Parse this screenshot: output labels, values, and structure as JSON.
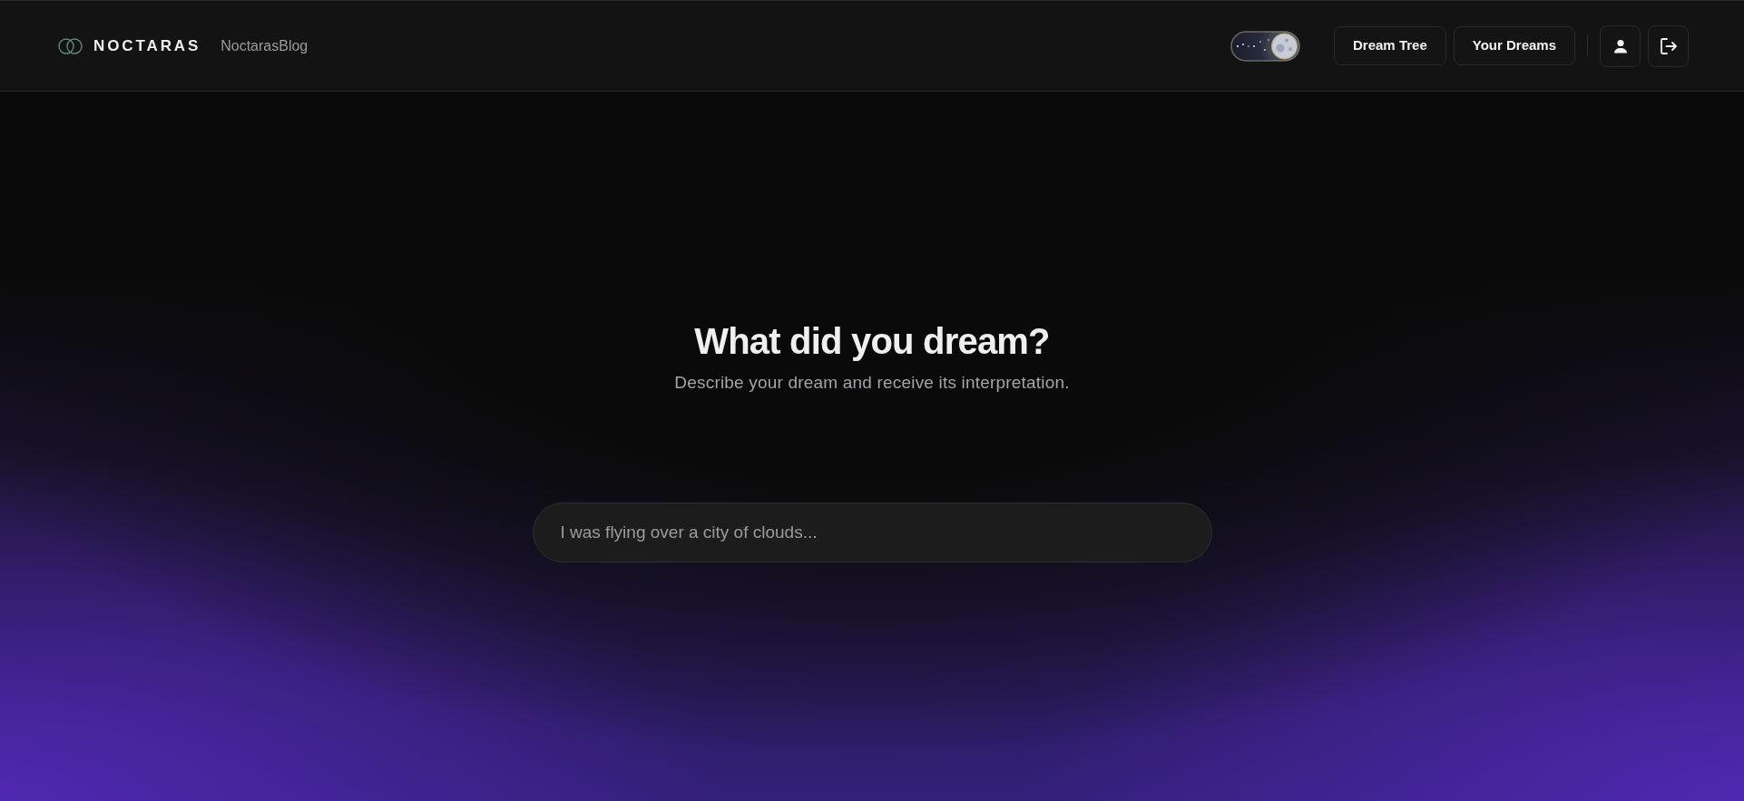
{
  "header": {
    "logo_text": "NOCTARAS",
    "blog_link": "NoctarasBlog",
    "theme_toggle": {
      "on": true
    },
    "nav_buttons": [
      "Dream Tree",
      "Your Dreams"
    ]
  },
  "hero": {
    "title": "What did you dream?",
    "subtitle": "Describe your dream and receive its interpretation."
  },
  "dream_input": {
    "placeholder": "I was flying over a city of clouds..."
  }
}
